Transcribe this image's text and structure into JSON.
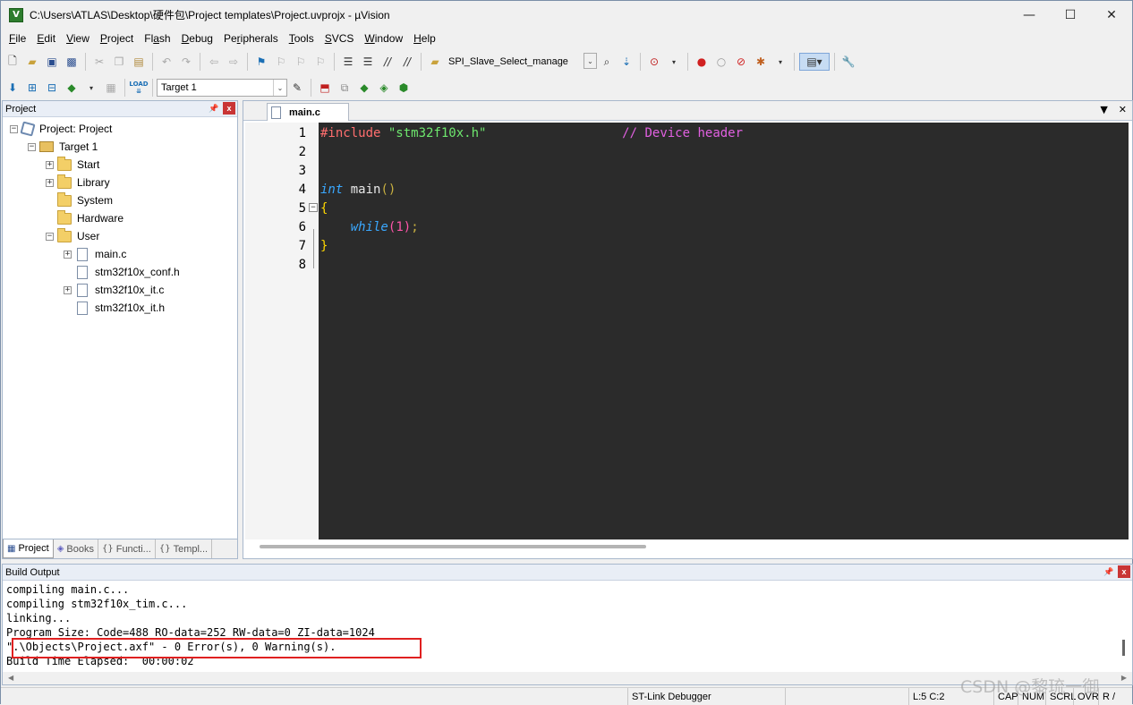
{
  "window": {
    "title": "C:\\Users\\ATLAS\\Desktop\\硬件包\\Project templates\\Project.uvprojx - µVision",
    "app_icon_glyph": "V",
    "minimize_glyph": "—",
    "maximize_glyph": "☐",
    "close_glyph": "✕"
  },
  "menu": {
    "items": [
      {
        "u": "F",
        "rest": "ile"
      },
      {
        "u": "E",
        "rest": "dit"
      },
      {
        "u": "V",
        "rest": "iew"
      },
      {
        "u": "P",
        "rest": "roject"
      },
      {
        "u": "",
        "pre": "Fl",
        "u2": "a",
        "rest": "sh"
      },
      {
        "u": "D",
        "rest": "ebug"
      },
      {
        "u": "",
        "pre": "Pe",
        "u2": "r",
        "rest": "ipherals"
      },
      {
        "u": "T",
        "rest": "ools"
      },
      {
        "u": "S",
        "rest": "VCS"
      },
      {
        "u": "W",
        "rest": "indow"
      },
      {
        "u": "H",
        "rest": "elp"
      }
    ]
  },
  "toolbar": {
    "function_combo": "SPI_Slave_Select_manage",
    "target_combo": "Target 1",
    "load_label": "LOAD"
  },
  "project_pane": {
    "header": "Project",
    "pin_glyph": "ᵖ",
    "close_glyph": "x",
    "root": "Project: Project",
    "target": "Target 1",
    "groups": [
      "Start",
      "Library",
      "System",
      "Hardware",
      "User"
    ],
    "files": [
      "main.c",
      "stm32f10x_conf.h",
      "stm32f10x_it.c",
      "stm32f10x_it.h"
    ],
    "tabs": [
      "Project",
      "Books",
      "Functi...",
      "Templ..."
    ],
    "tab_icons": [
      "▦",
      "◈",
      "{}",
      "{}"
    ]
  },
  "editor": {
    "tab": "main.c",
    "dropdown_glyph": "▼",
    "close_glyph": "✕",
    "line_numbers": [
      "1",
      "2",
      "3",
      "4",
      "5",
      "6",
      "7",
      "8"
    ],
    "line1": {
      "directive": "#include",
      "header": "\"stm32f10x.h\"",
      "spacer": "                  ",
      "comment": "// Device header"
    },
    "line4": {
      "kw": "int",
      "name": " main",
      "parens": "()"
    },
    "line5": {
      "brace": "{"
    },
    "line6": {
      "indent": "    ",
      "kw": "while",
      "p1": "(",
      "num": "1",
      "p2": ")",
      "semi": ";"
    },
    "line7": {
      "brace": "}"
    },
    "fold_glyph": "−"
  },
  "build_output": {
    "header": "Build Output",
    "lines": [
      "compiling main.c...",
      "compiling stm32f10x_tim.c...",
      "linking...",
      "Program Size: Code=488 RO-data=252 RW-data=0 ZI-data=1024",
      "\".\\Objects\\Project.axf\" - 0 Error(s), 0 Warning(s).",
      "Build Time Elapsed:  00:00:02"
    ],
    "scroll_left": "◀",
    "scroll_right": "▶"
  },
  "status": {
    "debugger": "ST-Link Debugger",
    "position": "L:5 C:2",
    "cap": "CAP",
    "num": "NUM",
    "scrl": "SCRL",
    "ovr": "OVR",
    "rw": "R /"
  },
  "watermark": "CSDN @黎琉一御",
  "colors": {
    "editor_bg": "#2b2b2b",
    "directive": "#ff6e6e",
    "string": "#6ee86e",
    "comment": "#e060e0",
    "keyword": "#3aa8ff",
    "identifier": "#e8e8e8",
    "paren": "#c8b040",
    "number": "#ff55aa",
    "brace": "#ffd700",
    "highlight_box": "#e02020"
  }
}
